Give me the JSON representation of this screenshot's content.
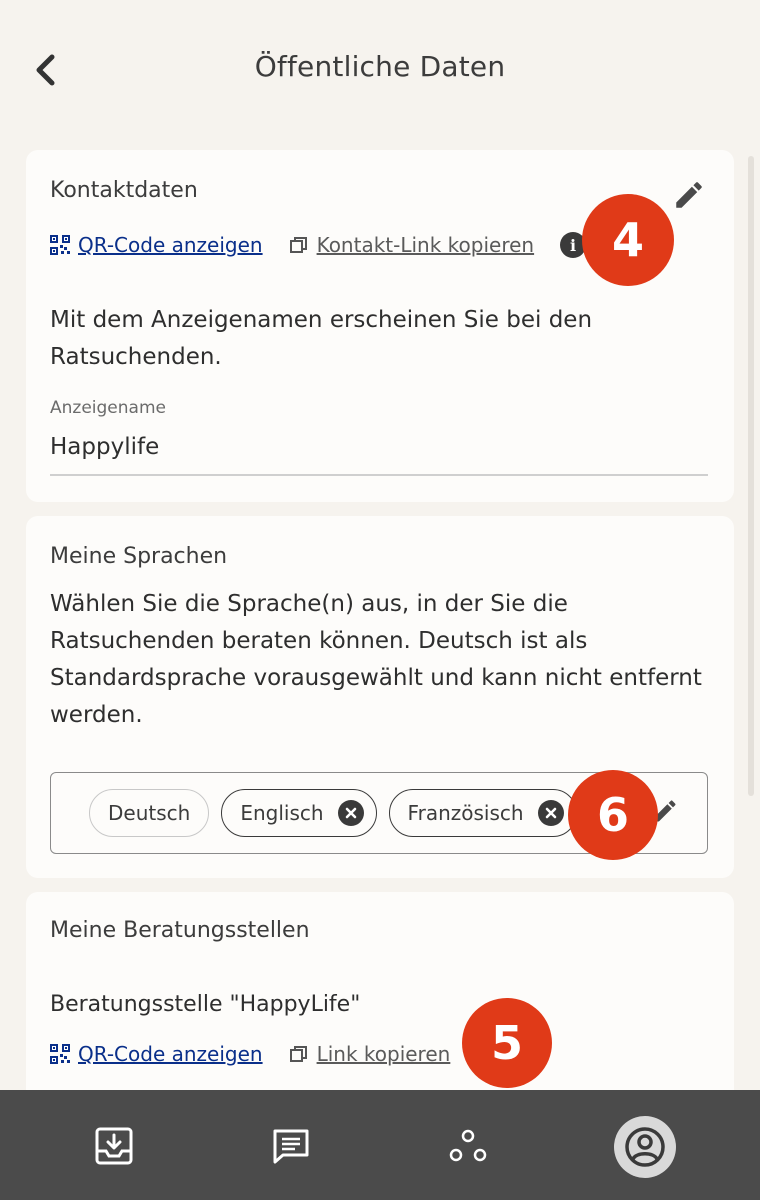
{
  "header": {
    "title": "Öffentliche Daten",
    "back_icon": "chevron-left-icon"
  },
  "contact": {
    "heading": "Kontaktdaten",
    "qr_label": "QR-Code anzeigen",
    "copy_label": "Kontakt-Link kopieren",
    "description": "Mit dem Anzeigenamen erscheinen Sie bei den Ratsuchenden.",
    "field_label": "Anzeigename",
    "field_value": "Happylife",
    "badge": "4"
  },
  "languages": {
    "heading": "Meine Sprachen",
    "description": "Wählen Sie die Sprache(n) aus, in der Sie die Ratsuchenden beraten können. Deutsch ist als Standardsprache vorausgewählt und kann nicht entfernt werden.",
    "chips": [
      "Deutsch",
      "Englisch",
      "Französisch"
    ],
    "badge": "6"
  },
  "agencies": {
    "heading": "Meine Beratungsstellen",
    "agency_name": "Beratungsstelle \"HappyLife\"",
    "qr_label": "QR-Code anzeigen",
    "copy_label": "Link kopieren",
    "badge": "5"
  },
  "nav": {
    "items": [
      "inbox-icon",
      "messages-icon",
      "group-icon",
      "profile-icon"
    ],
    "active": "profile-icon"
  },
  "colors": {
    "background": "#f6f3ee",
    "card": "#fdfcfa",
    "link": "#0a2f8a",
    "badge": "#e03a18",
    "navbar": "#4b4b4b"
  }
}
